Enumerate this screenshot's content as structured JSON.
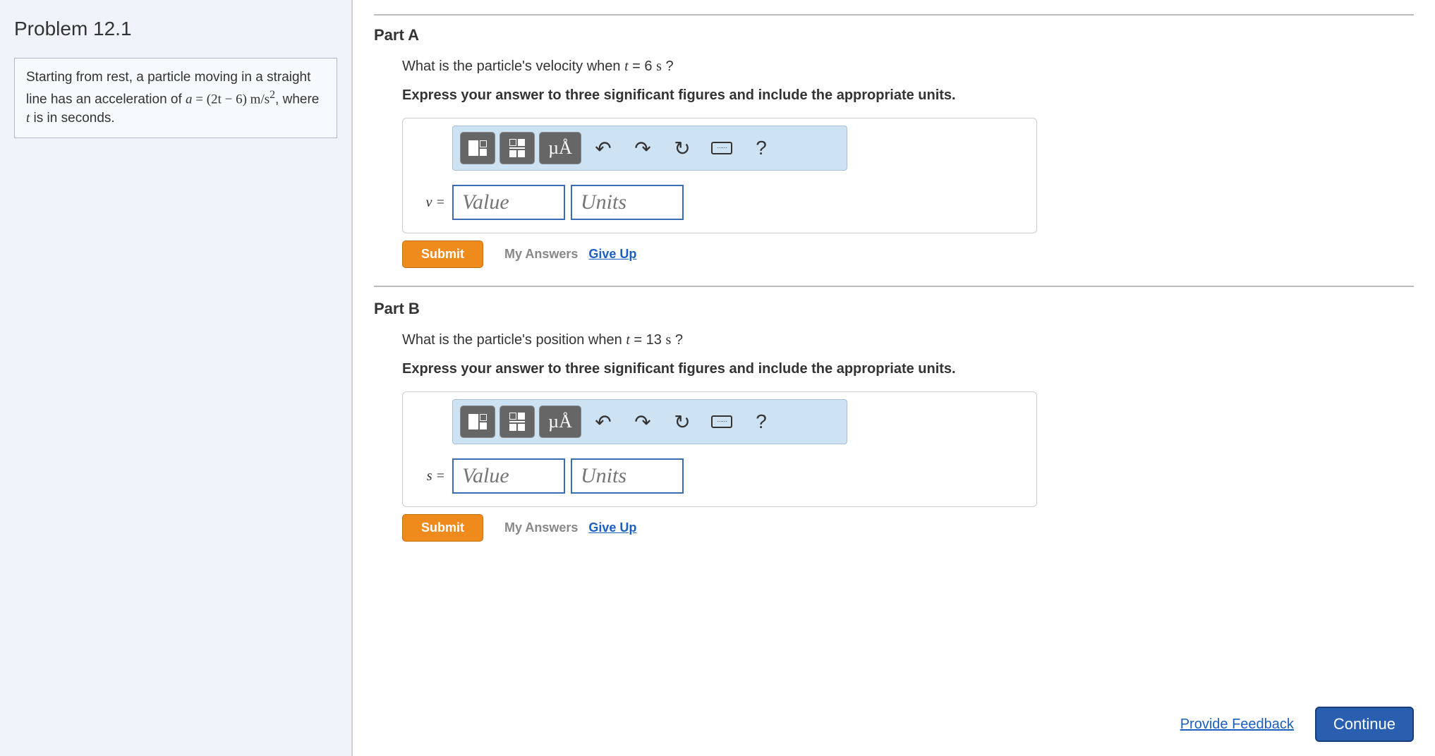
{
  "problem": {
    "title": "Problem 12.1",
    "statement_prefix": "Starting from rest, a particle moving in a straight line has an acceleration of ",
    "equation_lhs": "a",
    "equation_rhs": "(2t − 6)",
    "equation_units": "m/s",
    "equation_units_exp": "2",
    "statement_suffix": ", where ",
    "statement_var": "t",
    "statement_end": " is in seconds."
  },
  "partA": {
    "heading": "Part A",
    "question_prefix": "What is the particle's velocity when ",
    "question_var": "t",
    "question_eq": " = 6 ",
    "question_unit": "s",
    "question_suffix": " ?",
    "instruction": "Express your answer to three significant figures and include the appropriate units.",
    "var_label": "v =",
    "value_placeholder": "Value",
    "units_placeholder": "Units",
    "submit": "Submit",
    "my_answers": "My Answers",
    "give_up": "Give Up"
  },
  "partB": {
    "heading": "Part B",
    "question_prefix": "What is the particle's position when ",
    "question_var": "t",
    "question_eq": " = 13 ",
    "question_unit": "s",
    "question_suffix": " ?",
    "instruction": "Express your answer to three significant figures and include the appropriate units.",
    "var_label": "s =",
    "value_placeholder": "Value",
    "units_placeholder": "Units",
    "submit": "Submit",
    "my_answers": "My Answers",
    "give_up": "Give Up"
  },
  "toolbar": {
    "special_chars": "µÅ",
    "help": "?"
  },
  "footer": {
    "feedback": "Provide Feedback",
    "continue": "Continue"
  }
}
